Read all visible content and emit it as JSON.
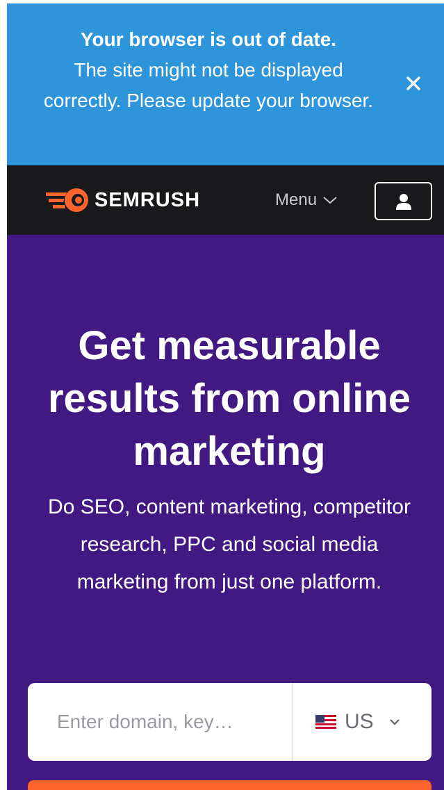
{
  "banner": {
    "title": "Your browser is out of date.",
    "message": "The site might not be displayed correctly. Please update your browser.",
    "close_icon": "close-icon"
  },
  "header": {
    "logo_text": "SEMRUSH",
    "menu_label": "Menu",
    "menu_icon": "chevron-down-icon",
    "user_icon": "user-icon"
  },
  "hero": {
    "title": "Get measurable results from online marketing",
    "subtitle": "Do SEO, content marketing, competitor research, PPC and social media marketing from just one platform."
  },
  "search": {
    "placeholder": "Enter domain, key…",
    "database_label": "US",
    "database_flag": "us-flag-icon"
  },
  "colors": {
    "banner_bg": "#2f95db",
    "header_bg": "#19191b",
    "hero_bg": "#421983",
    "accent": "#ff642d"
  }
}
